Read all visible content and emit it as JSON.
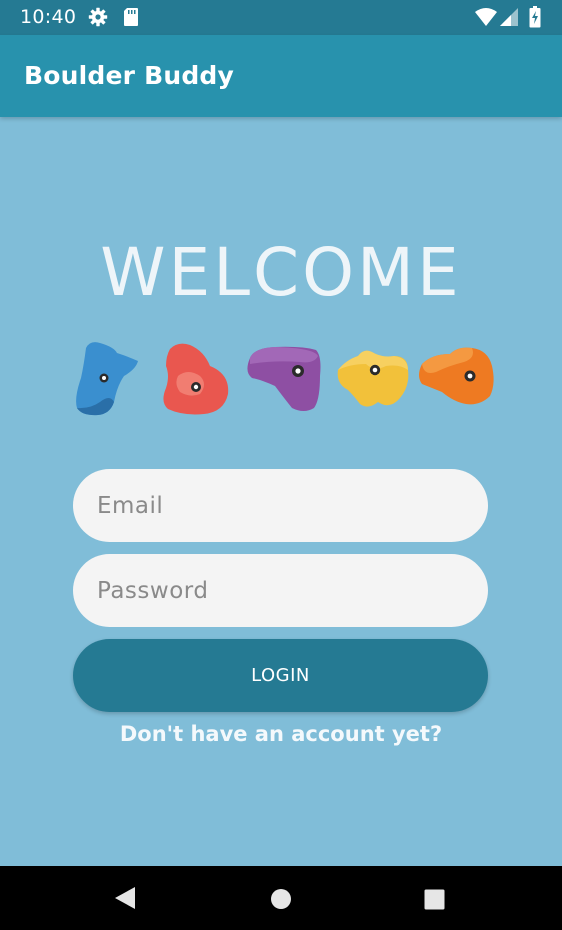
{
  "status_bar": {
    "time": "10:40",
    "icons": [
      "settings-gear-icon",
      "sd-card-icon",
      "wifi-icon",
      "cell-signal-icon",
      "battery-charging-icon"
    ]
  },
  "app_bar": {
    "title": "Boulder Buddy"
  },
  "welcome": {
    "heading": "WELCOME"
  },
  "holds": [
    {
      "name": "blue-hold-icon",
      "color": "#3a8fcf"
    },
    {
      "name": "red-hold-icon",
      "color": "#e9574f"
    },
    {
      "name": "purple-hold-icon",
      "color": "#8e4fa3"
    },
    {
      "name": "yellow-hold-icon",
      "color": "#f2c13a"
    },
    {
      "name": "orange-hold-icon",
      "color": "#ee7a22"
    }
  ],
  "form": {
    "email_placeholder": "Email",
    "password_placeholder": "Password",
    "email_value": "",
    "password_value": "",
    "login_label": "LOGIN",
    "signup_link": "Don't have an account yet?"
  },
  "nav_bar": {
    "buttons": [
      "back-icon",
      "home-icon",
      "recents-icon"
    ]
  },
  "colors": {
    "background": "#80bdd8",
    "app_bar": "#2892ad",
    "status_bar": "#257a93",
    "primary_button": "#257a93",
    "input_fill": "#f4f4f4"
  }
}
